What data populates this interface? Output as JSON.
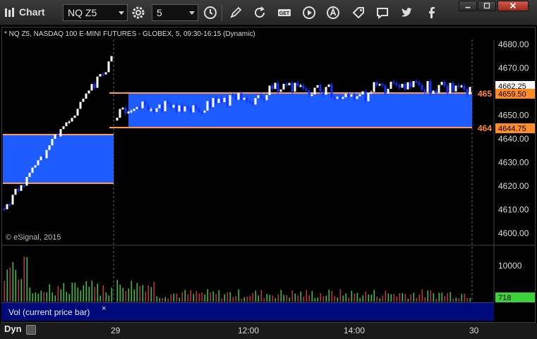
{
  "window": {
    "title": "Chart"
  },
  "toolbar": {
    "symbol": "NQ Z5",
    "interval": "5",
    "icons": [
      "settings-icon",
      "clock-icon",
      "pen-icon",
      "refresh-icon",
      "get-icon",
      "play-icon",
      "alert-icon",
      "tag-icon",
      "comment-icon",
      "twitter-icon",
      "facebook-icon"
    ]
  },
  "chart": {
    "header": "* NQ Z5, NASDAQ 100 E-MINI FUTURES - GLOBEX, 5, 09:30-16:15 (Dynamic)",
    "copyright": "© eSignal, 2015",
    "price_axis": [
      "4680.00",
      "4670.00",
      "4660.00",
      "4650.00",
      "4640.00",
      "4630.00",
      "4620.00",
      "4610.00",
      "4600.00"
    ],
    "last_price": "4662.25",
    "level_high": "4659.50",
    "level_low": "4644.75",
    "level_high_truncated": "465",
    "level_low_truncated": "464",
    "volume_axis": "10000",
    "volume_last": "718",
    "volume_label": "Vol (current price bar)",
    "volume_close": "×",
    "dyn_label": "Dyn",
    "x_labels": [
      "29",
      "12:00",
      "14:00",
      "30"
    ],
    "colors": {
      "zone": "#1f5cff",
      "level_line": "#ff9a55",
      "up_bar": "#ffffff",
      "down_bar": "#1432ff",
      "vol_up": "#32c832",
      "vol_down": "#c83232",
      "price_tag": "#ff8c28",
      "vol_tag": "#3cd23c"
    }
  }
}
